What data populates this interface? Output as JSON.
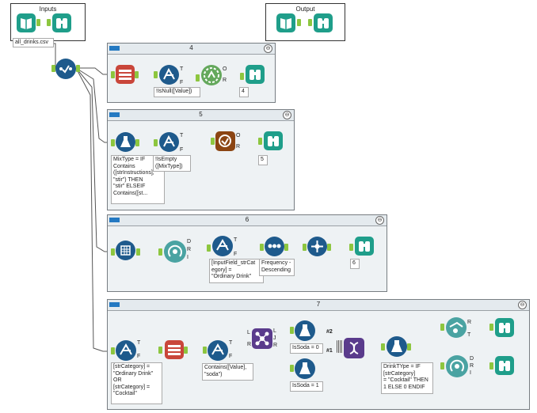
{
  "colors": {
    "teal": "#1f9e8a",
    "navy": "#1e5a8c",
    "red": "#c9463a",
    "brown": "#8b4513",
    "anchor": "#8dc63f",
    "badge": "#2479c2"
  },
  "boxes": {
    "inputs": "Inputs",
    "output": "Output"
  },
  "input_label": "all_drinks.csv",
  "containers": {
    "c4": "4",
    "c5": "5",
    "c6": "6",
    "c7": "7"
  },
  "collapse_symbol": "⊖",
  "annotations": {
    "c4_filter": "!IsNull([Value])",
    "c4_browse": "4",
    "c5_formula": "MixType = IF\nContains\n([strInstructions],\n\"stir\") THEN\n\"stir\" ELSEIF\nContains([st...",
    "c5_filter": "!IsEmpty\n([MixType])",
    "c5_browse": "5",
    "c6_filter": "[InputField_strCat\negory] =\n\"Ordinary Drink\"",
    "c6_sort": "Frequency -\nDescending",
    "c6_browse": "6",
    "c7_filter": "[strCategory] =\n\"Ordinary Drink\"\nOR\n[strCategory] =\n\"Cocktail\"",
    "c7_contains": "Contains([Value],\n\"soda\")",
    "c7_soda0": "IsSoda = 0",
    "c7_soda1": "IsSoda = 1",
    "c7_formula": "DrinkTYpe = IF\n[strCategory]\n= \"Cocktail\" THEN\n1 ELSE 0 ENDIF"
  },
  "union_labels": {
    "first": "#2",
    "second": "#1"
  },
  "port_letters": {
    "T": "T",
    "F": "F",
    "O": "O",
    "R": "R",
    "L": "L",
    "J": "J",
    "D": "D",
    "I": "I"
  },
  "icons": [
    "input-data-icon",
    "browse-icon",
    "select-records-icon",
    "filter-icon",
    "cross-tab-icon",
    "formula-icon",
    "summarize-icon",
    "transpose-icon",
    "sample-icon",
    "sort-icon",
    "random-sample-icon",
    "join-icon",
    "union-icon",
    "append-fields-icon",
    "auto-field-icon"
  ]
}
